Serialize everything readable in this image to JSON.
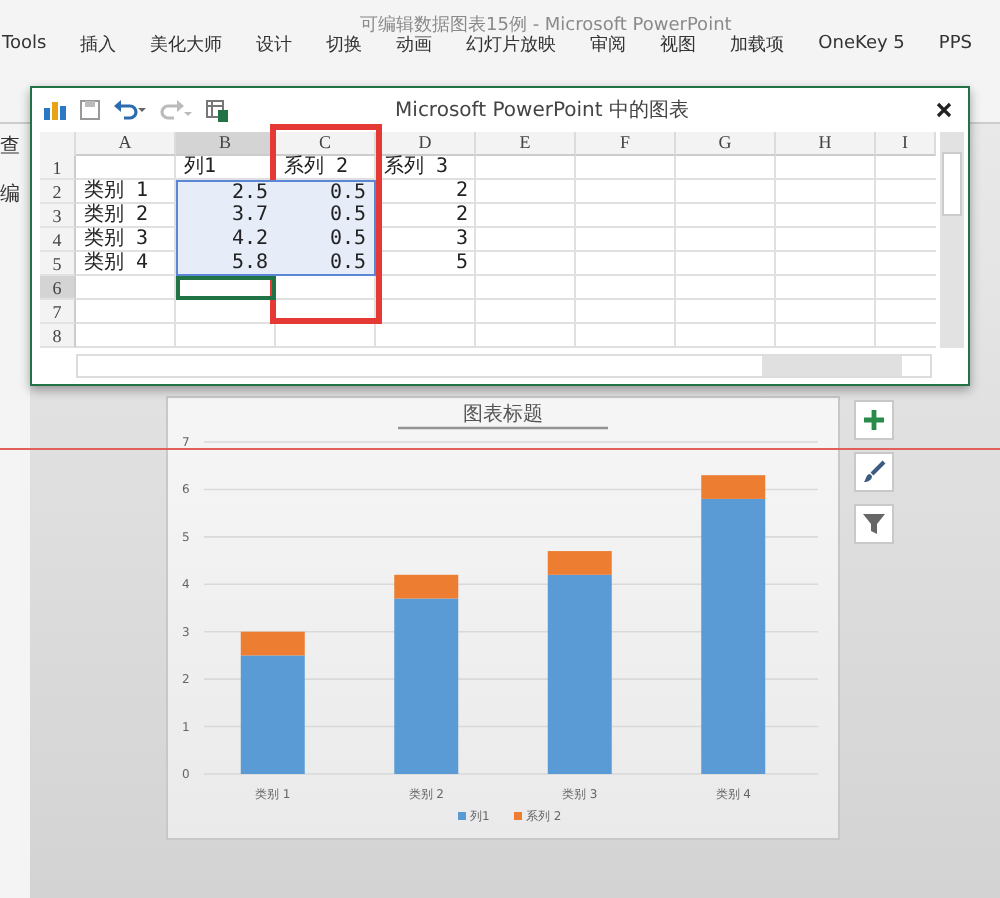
{
  "app_title": "可编辑数据图表15例 - Microsoft PowerPoint",
  "ribbon_tabs": [
    "Tools",
    "插入",
    "美化大师",
    "设计",
    "切换",
    "动画",
    "幻灯片放映",
    "审阅",
    "视图",
    "加载项",
    "OneKey 5",
    "PPS"
  ],
  "side_labels": [
    "查",
    "编"
  ],
  "sheet_window": {
    "title": "Microsoft PowerPoint 中的图表",
    "columns": [
      {
        "label": "A",
        "selected": false,
        "marked": false
      },
      {
        "label": "B",
        "selected": true,
        "marked": false
      },
      {
        "label": "C",
        "selected": false,
        "marked": true
      },
      {
        "label": "D",
        "selected": false,
        "marked": false
      },
      {
        "label": "E",
        "selected": false,
        "marked": false
      },
      {
        "label": "F",
        "selected": false,
        "marked": false
      },
      {
        "label": "G",
        "selected": false,
        "marked": false
      },
      {
        "label": "H",
        "selected": false,
        "marked": false
      },
      {
        "label": "I",
        "selected": false,
        "marked": false
      }
    ],
    "rows": [
      {
        "label": "1",
        "selected": false,
        "cells": [
          {
            "selected": false,
            "active": false
          },
          {
            "text": "列1",
            "selected": false,
            "active": false
          },
          {
            "text": "系列 2",
            "selected": false,
            "active": false
          },
          {
            "text": "系列 3",
            "selected": false,
            "active": false
          }
        ]
      },
      {
        "label": "2",
        "selected": false,
        "cells": [
          {
            "text": "类别 1",
            "selected": false,
            "active": false
          },
          {
            "text": "2.5",
            "selected": true,
            "active": false
          },
          {
            "text": "0.5",
            "selected": true,
            "active": false
          },
          {
            "text": "2",
            "selected": false,
            "active": false
          }
        ]
      },
      {
        "label": "3",
        "selected": false,
        "cells": [
          {
            "text": "类别 2",
            "selected": false,
            "active": false
          },
          {
            "text": "3.7",
            "selected": true,
            "active": false
          },
          {
            "text": "0.5",
            "selected": true,
            "active": false
          },
          {
            "text": "2",
            "selected": false,
            "active": false
          }
        ]
      },
      {
        "label": "4",
        "selected": false,
        "cells": [
          {
            "text": "类别 3",
            "selected": false,
            "active": false
          },
          {
            "text": "4.2",
            "selected": true,
            "active": false
          },
          {
            "text": "0.5",
            "selected": true,
            "active": false
          },
          {
            "text": "3",
            "selected": false,
            "active": false
          }
        ]
      },
      {
        "label": "5",
        "selected": false,
        "cells": [
          {
            "text": "类别 4",
            "selected": false,
            "active": false
          },
          {
            "text": "5.8",
            "selected": true,
            "active": false
          },
          {
            "text": "0.5",
            "selected": true,
            "active": false
          },
          {
            "text": "5",
            "selected": false,
            "active": false
          }
        ]
      },
      {
        "label": "6",
        "selected": true,
        "cells": [
          {
            "selected": false,
            "active": false
          },
          {
            "selected": false,
            "active": true
          }
        ]
      },
      {
        "label": "7",
        "selected": false,
        "cells": []
      },
      {
        "label": "8",
        "selected": false,
        "cells": []
      }
    ]
  },
  "chart": {
    "chart_data": {
      "type": "bar",
      "title": "图表标题",
      "categories": [
        "类别 1",
        "类别 2",
        "类别 3",
        "类别 4"
      ],
      "series": [
        {
          "name": "列1",
          "color": "#5b9bd5",
          "values": [
            2.5,
            3.7,
            4.2,
            5.8
          ]
        },
        {
          "name": "系列 2",
          "color": "#ed7d31",
          "values": [
            0.5,
            0.5,
            0.5,
            0.5
          ]
        }
      ],
      "stacked": true,
      "ylim": [
        0,
        7
      ],
      "yticks": [
        0,
        1,
        2,
        3,
        4,
        5,
        6,
        7
      ],
      "grid": true,
      "legend": true
    }
  }
}
